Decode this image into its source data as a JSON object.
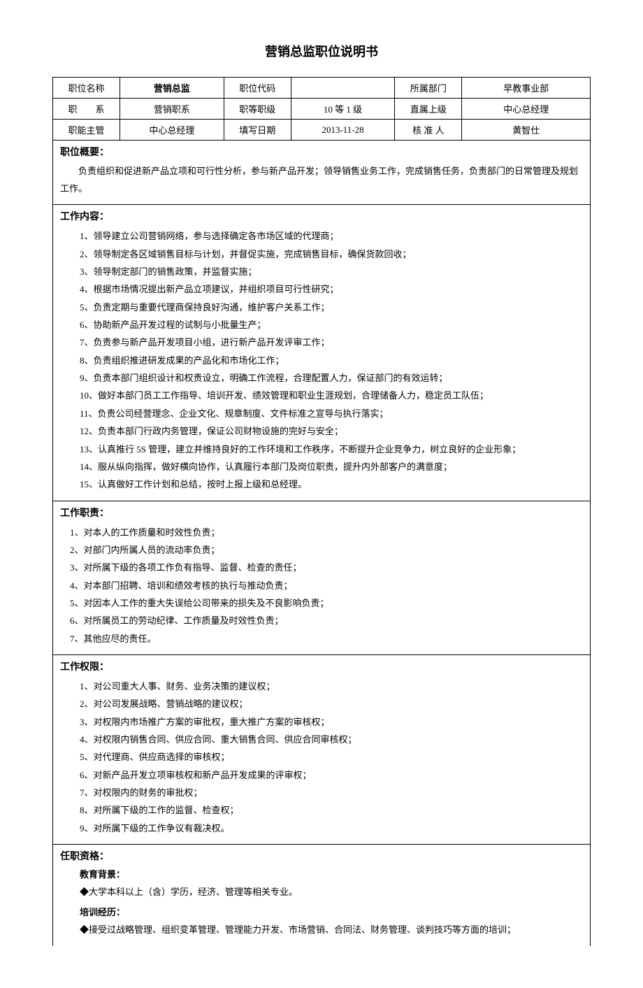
{
  "title": "营销总监职位说明书",
  "header": {
    "row1": {
      "label1": "职位名称",
      "value1": "营销总监",
      "label2": "职位代码",
      "value2": "",
      "label3": "所属部门",
      "value3": "早教事业部"
    },
    "row2": {
      "label1": "职　　系",
      "value1": "营销职系",
      "label2": "职等职级",
      "value2": "10 等 1 级",
      "label3": "直属上级",
      "value3": "中心总经理"
    },
    "row3": {
      "label1": "职能主管",
      "value1": "中心总经理",
      "label2": "填写日期",
      "value2": "2013-11-28",
      "label3": "核 准 人",
      "value3": "黄智仕"
    }
  },
  "overview": {
    "title": "职位概要：",
    "text": "负责组织和促进新产品立项和可行性分析，参与新产品开发；领导销售业务工作，完成销售任务，负责部门的日常管理及规划工作。"
  },
  "workContent": {
    "title": "工作内容：",
    "items": [
      "1、领导建立公司营销网络，参与选择确定各市场区域的代理商；",
      "2、领导制定各区域销售目标与计划，并督促实施，完成销售目标，确保货款回收；",
      "3、领导制定部门的销售政策，并监督实施；",
      "4、根据市场情况提出新产品立项建议，并组织项目可行性研究；",
      "5、负责定期与重要代理商保持良好沟通，维护客户关系工作；",
      "6、协助新产品开发过程的试制与小批量生产；",
      "7、负责参与新产品开发项目小组，进行新产品开发评审工作；",
      "8、负责组织推进研发成果的产品化和市场化工作；",
      "9、负责本部门组织设计和权责设立，明确工作流程，合理配置人力，保证部门的有效运转；",
      "10、做好本部门员工工作指导、培训开发、绩效管理和职业生涯规划，合理储备人力，稳定员工队伍；",
      "11、负责公司经营理念、企业文化、规章制度、文件标准之宣导与执行落实；",
      "12、负责本部门行政内务管理，保证公司财物设施的完好与安全；",
      "13、认真推行 5S 管理，建立并维持良好的工作环境和工作秩序，不断提升企业竞争力，树立良好的企业形象；",
      "14、服从纵向指挥，做好横向协作，认真履行本部门及岗位职责，提升内外部客户的满意度；",
      "15、认真做好工作计划和总结，按时上报上级和总经理。"
    ]
  },
  "duties": {
    "title": "工作职责：",
    "items": [
      "1、对本人的工作质量和时效性负责；",
      "2、对部门内所属人员的流动率负责；",
      "3、对所属下级的各项工作负有指导、监督、检查的责任；",
      "4、对本部门招聘、培训和绩效考核的执行与推动负责；",
      "5、对因本人工作的重大失误给公司带来的损失及不良影响负责；",
      "6、对所属员工的劳动纪律、工作质量及时效性负责；",
      "7、其他应尽的责任。"
    ]
  },
  "authority": {
    "title": "工作权限：",
    "items": [
      "1、对公司重大人事、财务、业务决策的建议权；",
      "2、对公司发展战略、营销战略的建议权；",
      "3、对权限内市场推广方案的审批权，重大推广方案的审核权；",
      "4、对权限内销售合同、供应合同、重大销售合同、供应合同审核权；",
      "5、对代理商、供应商选择的审核权；",
      "6、对新产品开发立项审核权和新产品开发成果的评审权；",
      "7、对权限内的财务的审批权；",
      "8、对所属下级的工作的监督、检查权；",
      "9、对所属下级的工作争议有裁决权。"
    ]
  },
  "qualifications": {
    "title": "任职资格：",
    "education": {
      "title": "教育背景：",
      "text": "◆大学本科以上（含）学历，经济、管理等相关专业。"
    },
    "training": {
      "title": "培训经历：",
      "text": "◆接受过战略管理、组织变革管理、管理能力开发、市场营销、合同法、财务管理、谈判技巧等方面的培训；"
    }
  }
}
